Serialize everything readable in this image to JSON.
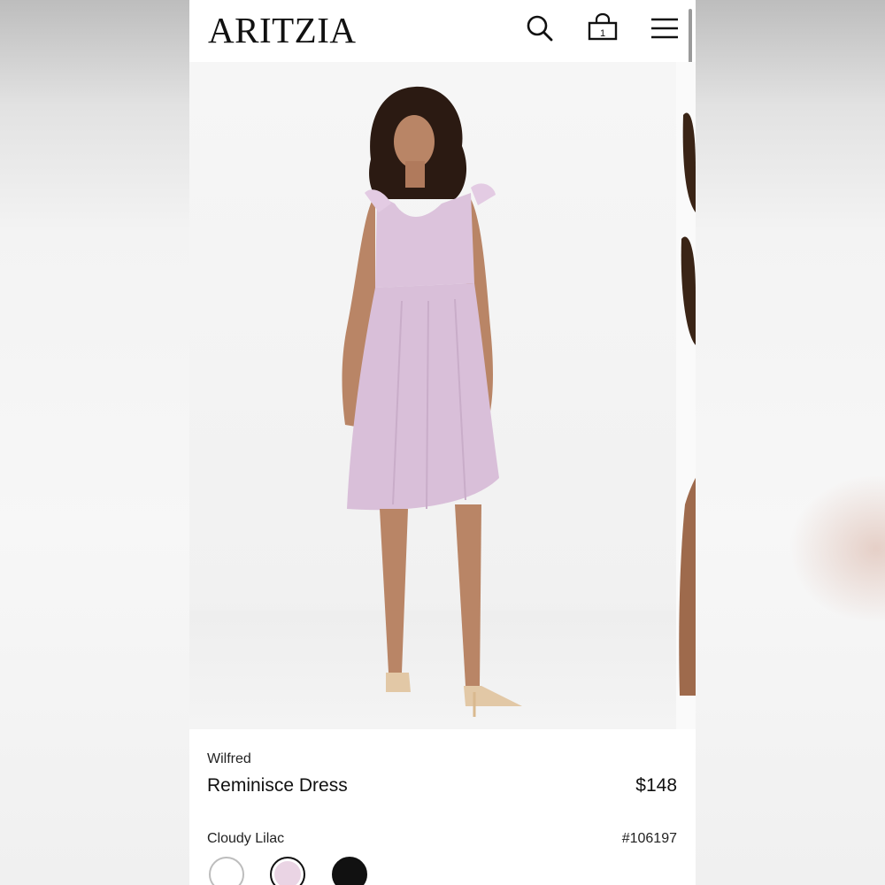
{
  "header": {
    "logo": "ARITZIA",
    "cart_count": "1",
    "icons": [
      "search-icon",
      "shopping-bag-icon",
      "hamburger-menu-icon"
    ]
  },
  "product": {
    "brand": "Wilfred",
    "name": "Reminisce Dress",
    "price": "$148",
    "color_name": "Cloudy Lilac",
    "sku": "#106197"
  },
  "swatches": [
    {
      "name": "white",
      "color": "#ffffff"
    },
    {
      "name": "cloudy-lilac",
      "color": "#ead4e4",
      "selected": true
    },
    {
      "name": "black",
      "color": "#111111"
    }
  ],
  "colors": {
    "dress": "#dcc3dc",
    "skin": "#b98566",
    "hair": "#2b1a12"
  }
}
